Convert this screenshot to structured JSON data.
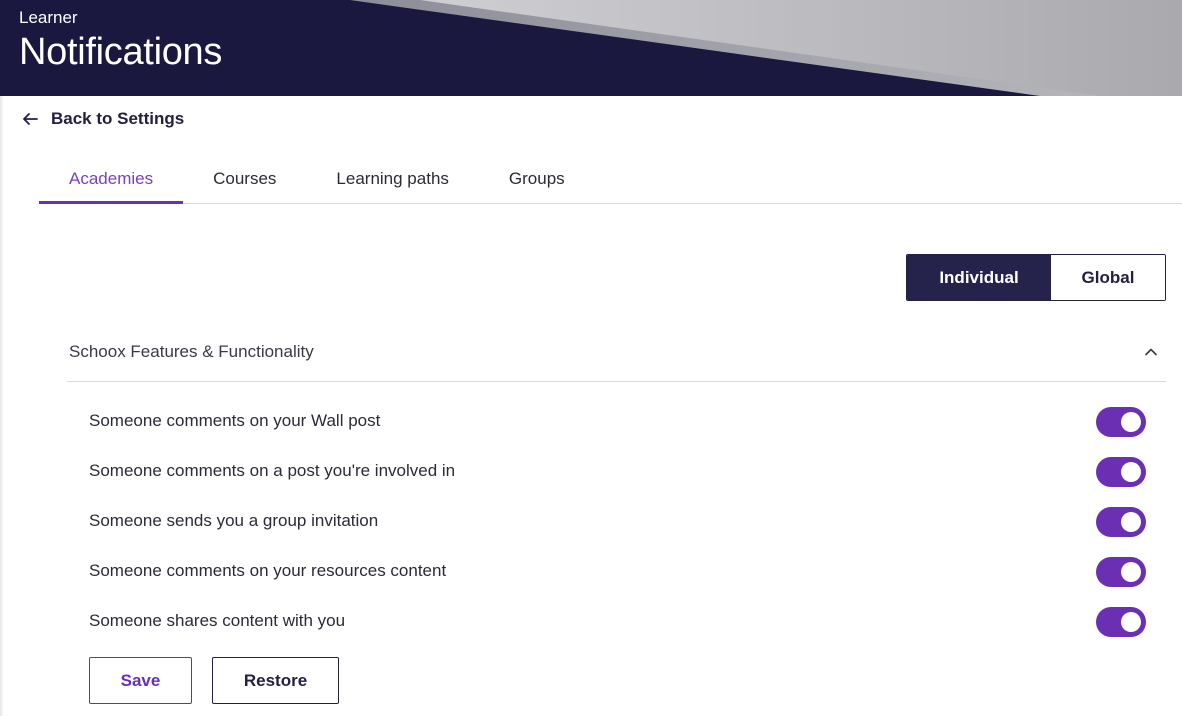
{
  "header": {
    "role": "Learner",
    "title": "Notifications"
  },
  "back_link": {
    "label": "Back to Settings",
    "icon": "arrow-left-icon"
  },
  "tabs": [
    {
      "label": "Academies",
      "active": true
    },
    {
      "label": "Courses",
      "active": false
    },
    {
      "label": "Learning paths",
      "active": false
    },
    {
      "label": "Groups",
      "active": false
    }
  ],
  "scope_toggle": {
    "options": [
      "Individual",
      "Global"
    ],
    "selected": "Individual"
  },
  "section": {
    "title": "Schoox Features & Functionality",
    "expanded": true,
    "icon": "chevron-up-icon"
  },
  "settings": [
    {
      "label": "Someone comments on your Wall post",
      "enabled": true
    },
    {
      "label": "Someone comments on a post you're involved in",
      "enabled": true
    },
    {
      "label": "Someone sends you a group invitation",
      "enabled": true
    },
    {
      "label": "Someone comments on your resources content",
      "enabled": true
    },
    {
      "label": "Someone shares content with you",
      "enabled": true
    }
  ],
  "actions": {
    "save_label": "Save",
    "restore_label": "Restore"
  },
  "colors": {
    "header_bg": "#1b1840",
    "accent_purple": "#6a2fb3",
    "active_tab_text": "#7b3fc4",
    "segment_selected_bg": "#25224c"
  }
}
